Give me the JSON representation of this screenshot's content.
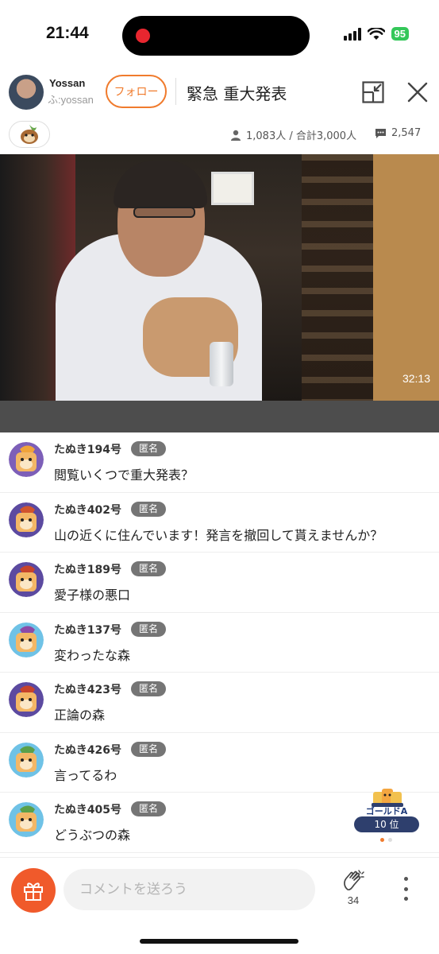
{
  "status_bar": {
    "time": "21:44",
    "battery": "95"
  },
  "header": {
    "host_name": "Yossan",
    "host_id": "ふ:yossan",
    "follow_label": "フォロー",
    "stream_title": "緊急 重大発表"
  },
  "stats": {
    "viewers": "1,083人 / 合計3,000人",
    "comments": "2,547"
  },
  "video": {
    "elapsed": "32:13"
  },
  "comments": [
    {
      "name": "たぬき194号",
      "badge": "匿名",
      "text": "閲覧いくつで重大発表？",
      "avatar_color": "#7d5fb8",
      "leaf_color": "#f0a33a"
    },
    {
      "name": "たぬき402号",
      "badge": "匿名",
      "text": "山の近くに住んでいます！発言を撤回して貰えませんか？",
      "avatar_color": "#5c4aa0",
      "leaf_color": "#d0542d"
    },
    {
      "name": "たぬき189号",
      "badge": "匿名",
      "text": "愛子様の悪口",
      "avatar_color": "#5c4aa0",
      "leaf_color": "#c7432a"
    },
    {
      "name": "たぬき137号",
      "badge": "匿名",
      "text": "変わったな森",
      "avatar_color": "#6fc2e6",
      "leaf_color": "#8b4aa8"
    },
    {
      "name": "たぬき423号",
      "badge": "匿名",
      "text": "正論の森",
      "avatar_color": "#5c4aa0",
      "leaf_color": "#c7432a"
    },
    {
      "name": "たぬき426号",
      "badge": "匿名",
      "text": "言ってるわ",
      "avatar_color": "#6fc2e6",
      "leaf_color": "#5aa04a"
    },
    {
      "name": "たぬき405号",
      "badge": "匿名",
      "text": "どうぶつの森",
      "avatar_color": "#6fc2e6",
      "leaf_color": "#5aa04a"
    }
  ],
  "rank": {
    "label": "ゴールドA",
    "position": "10 位"
  },
  "bottom_bar": {
    "comment_placeholder": "コメントを送ろう",
    "clap_count": "34"
  },
  "colors": {
    "accent": "#f07b2d",
    "gift": "#f05a2b",
    "badge_gray": "#757575",
    "rank_navy": "#2e3f6d"
  },
  "icons": [
    "person-icon",
    "comment-bubble-icon",
    "minimize-icon",
    "close-icon",
    "gift-icon",
    "clap-icon",
    "more-icon",
    "tanuki-badge-icon"
  ]
}
